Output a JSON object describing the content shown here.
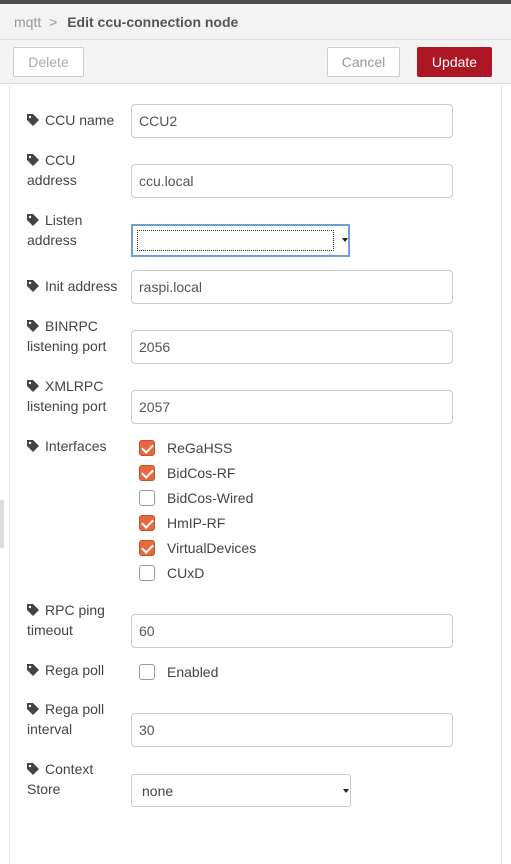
{
  "header": {
    "parent": "mqtt",
    "separator": ">",
    "title": "Edit ccu-connection node"
  },
  "buttons": {
    "delete": "Delete",
    "cancel": "Cancel",
    "update": "Update"
  },
  "colors": {
    "update_button": "#ad1625",
    "checkbox_checked": "#e8693e",
    "focus_border": "#6e9ed7"
  },
  "fields": {
    "ccu_name": {
      "label": "CCU name",
      "value": "CCU2"
    },
    "ccu_address": {
      "label_line1": "CCU",
      "label_line2": "address",
      "value": "ccu.local"
    },
    "listen_address": {
      "label_line1": "Listen",
      "label_line2": "address",
      "value": ""
    },
    "init_address": {
      "label": "Init address",
      "value": "raspi.local"
    },
    "binrpc_port": {
      "label_line1": "BINRPC",
      "label_line2": "listening port",
      "value": "2056"
    },
    "xmlrpc_port": {
      "label_line1": "XMLRPC",
      "label_line2": "listening port",
      "value": "2057"
    },
    "interfaces": {
      "label": "Interfaces",
      "options": [
        {
          "label": "ReGaHSS",
          "checked": true
        },
        {
          "label": "BidCos-RF",
          "checked": true
        },
        {
          "label": "BidCos-Wired",
          "checked": false
        },
        {
          "label": "HmIP-RF",
          "checked": true
        },
        {
          "label": "VirtualDevices",
          "checked": true
        },
        {
          "label": "CUxD",
          "checked": false
        }
      ]
    },
    "rpc_ping_timeout": {
      "label_line1": "RPC ping",
      "label_line2": "timeout",
      "value": "60"
    },
    "rega_poll": {
      "label": "Rega poll",
      "option": "Enabled",
      "checked": false
    },
    "rega_poll_interval": {
      "label_line1": "Rega poll",
      "label_line2": "interval",
      "value": "30"
    },
    "context_store": {
      "label_line1": "Context",
      "label_line2": "Store",
      "value": "none"
    }
  }
}
